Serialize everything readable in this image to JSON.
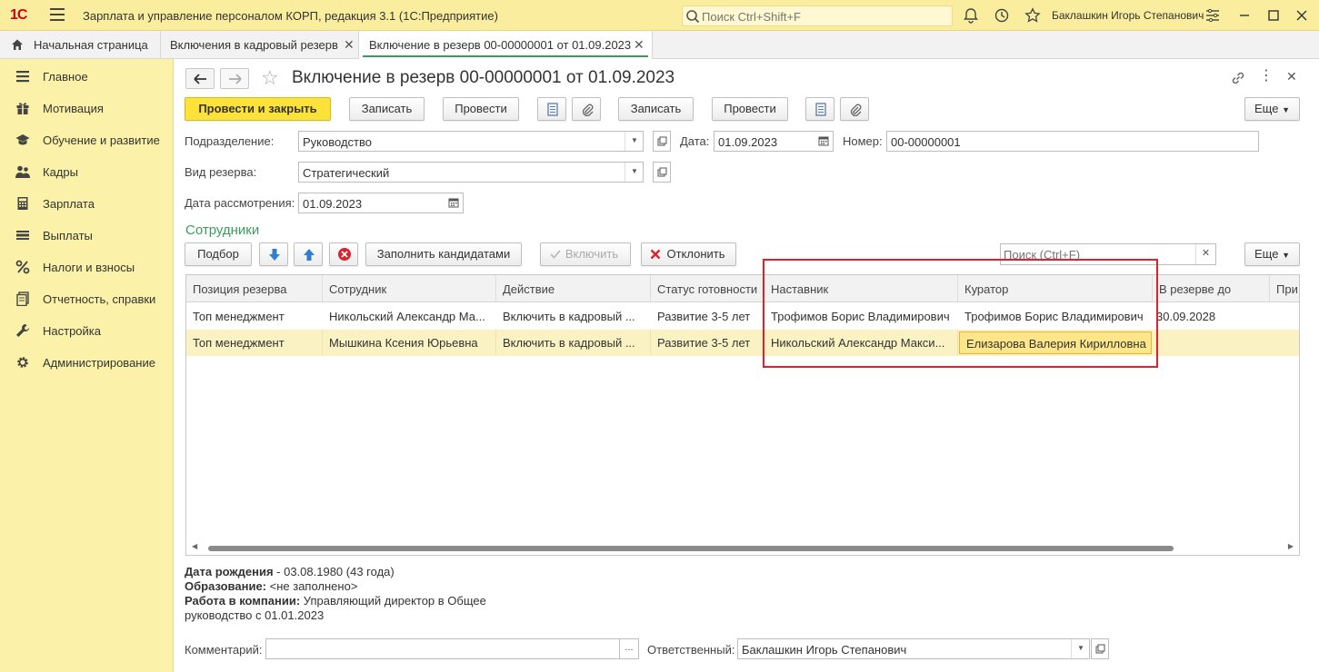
{
  "window": {
    "logo": "1С",
    "title": "Зарплата и управление персоналом КОРП, редакция 3.1  (1С:Предприятие)",
    "search_placeholder": "Поиск Ctrl+Shift+F",
    "user": "Баклашкин Игорь Степанович"
  },
  "tabs": [
    {
      "label": "Начальная страница"
    },
    {
      "label": "Включения в кадровый резерв"
    },
    {
      "label": "Включение в резерв 00-00000001 от 01.09.2023"
    }
  ],
  "sidebar": {
    "items": [
      {
        "label": "Главное",
        "icon": "list-icon"
      },
      {
        "label": "Мотивация",
        "icon": "gift-icon"
      },
      {
        "label": "Обучение и развитие",
        "icon": "graduation-cap-icon"
      },
      {
        "label": "Кадры",
        "icon": "people-icon"
      },
      {
        "label": "Зарплата",
        "icon": "calculator-icon"
      },
      {
        "label": "Выплаты",
        "icon": "wallet-icon"
      },
      {
        "label": "Налоги и взносы",
        "icon": "percent-icon"
      },
      {
        "label": "Отчетность, справки",
        "icon": "report-icon"
      },
      {
        "label": "Настройка",
        "icon": "wrench-icon"
      },
      {
        "label": "Администрирование",
        "icon": "gear-icon"
      }
    ]
  },
  "document": {
    "title": "Включение в резерв 00-00000001 от 01.09.2023"
  },
  "toolbar": {
    "post_close": "Провести и закрыть",
    "save": "Записать",
    "post": "Провести",
    "save2": "Записать",
    "post2": "Провести",
    "more": "Еще"
  },
  "form": {
    "department_label": "Подразделение:",
    "department_value": "Руководство",
    "date_label": "Дата:",
    "date_value": "01.09.2023",
    "number_label": "Номер:",
    "number_value": "00-00000001",
    "reserve_type_label": "Вид резерва:",
    "reserve_type_value": "Стратегический",
    "review_date_label": "Дата рассмотрения:",
    "review_date_value": "01.09.2023"
  },
  "employees": {
    "section_title": "Сотрудники",
    "pick": "Подбор",
    "fill_candidates": "Заполнить кандидатами",
    "include": "Включить",
    "reject": "Отклонить",
    "search_placeholder": "Поиск (Ctrl+F)",
    "more": "Еще",
    "columns": [
      "Позиция резерва",
      "Сотрудник",
      "Действие",
      "Статус готовности",
      "Наставник",
      "Куратор",
      "В резерве до",
      "При"
    ],
    "rows": [
      {
        "position": "Топ менеджмент",
        "employee": "Никольский Александр Ма...",
        "action": "Включить в кадровый ...",
        "status": "Развитие 3-5 лет",
        "mentor": "Трофимов Борис Владимирович",
        "curator": "Трофимов Борис Владимирович",
        "until": "30.09.2028"
      },
      {
        "position": "Топ менеджмент",
        "employee": "Мышкина Ксения Юрьевна",
        "action": "Включить в кадровый ...",
        "status": "Развитие 3-5 лет",
        "mentor": "Никольский Александр Макси...",
        "curator": "Елизарова Валерия Кирилловна",
        "until": ""
      }
    ]
  },
  "details": {
    "birth_label": "Дата рождения",
    "birth_value": " - 03.08.1980 (43 года)",
    "education_label": "Образование:",
    "education_value": " <не заполнено>",
    "work_label": "Работа в компании:",
    "work_value": " Управляющий директор в Общее",
    "work_value2": "руководство с 01.01.2023"
  },
  "footer": {
    "comment_label": "Комментарий:",
    "comment_value": "",
    "comment_button": "...",
    "responsible_label": "Ответственный:",
    "responsible_value": "Баклашкин Игорь Степанович"
  }
}
